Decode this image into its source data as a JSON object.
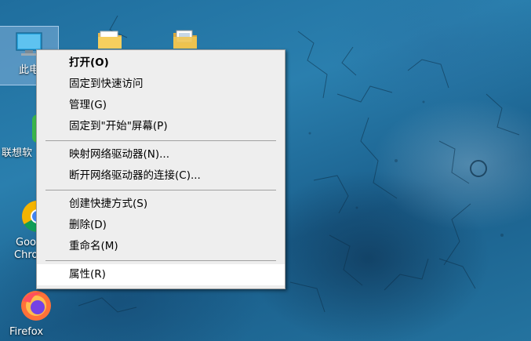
{
  "desktop": {
    "icons": [
      {
        "label": "此电脑",
        "icon": "this-pc-icon"
      },
      {
        "label": "联想软件",
        "icon": "lenovo-app-icon"
      },
      {
        "label": "Google Chrome",
        "icon": "chrome-icon"
      },
      {
        "label": "Firefox",
        "icon": "firefox-icon"
      },
      {
        "label": "",
        "icon": "folder-icon"
      },
      {
        "label": "",
        "icon": "folder-icon"
      }
    ],
    "visible_labels": {
      "this_pc": "此电",
      "lenovo": "联想软",
      "chrome_line1": "Goo",
      "chrome_line2": "Chro",
      "firefox": "Firefox"
    }
  },
  "context_menu": {
    "items": [
      {
        "label": "打开(O)",
        "bold": true
      },
      {
        "label": "固定到快速访问"
      },
      {
        "label": "管理(G)"
      },
      {
        "label": "固定到\"开始\"屏幕(P)"
      },
      {
        "label": "映射网络驱动器(N)..."
      },
      {
        "label": "断开网络驱动器的连接(C)..."
      },
      {
        "label": "创建快捷方式(S)"
      },
      {
        "label": "删除(D)"
      },
      {
        "label": "重命名(M)"
      },
      {
        "label": "属性(R)",
        "hovered": true
      }
    ]
  },
  "colors": {
    "menu_bg": "#eeeeee",
    "menu_hover": "#ffffff",
    "wallpaper": "#2a7fae",
    "lenovo_green": "#3bb54a",
    "firefox_orange": "#ff7139"
  }
}
